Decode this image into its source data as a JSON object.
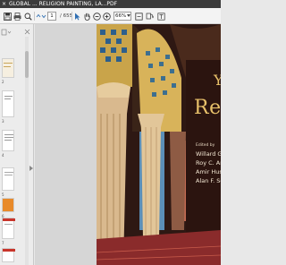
{
  "window": {
    "tab_close": "×",
    "title": "GLOBAL ... RELIGION PAINTING, LA...PDF"
  },
  "toolbar": {
    "page_current": "1",
    "page_total": "/ 655",
    "zoom": "66%",
    "icons": [
      "save-icon",
      "print-icon",
      "search-icon",
      "page-up-icon",
      "page-down-icon",
      "select-cursor-icon",
      "hand-tool-icon",
      "zoom-out-icon",
      "zoom-in-icon",
      "fit-page-icon",
      "rotate-icon",
      "share-icon"
    ]
  },
  "sidebar": {
    "thumbnails": [
      {
        "num": "1",
        "style": "cover"
      },
      {
        "num": "2",
        "style": "text"
      },
      {
        "num": "3",
        "style": "text"
      },
      {
        "num": "4",
        "style": "text"
      },
      {
        "num": "5",
        "style": "orange"
      },
      {
        "num": "6",
        "style": "red"
      },
      {
        "num": "7",
        "style": "red"
      },
      {
        "num": "8",
        "style": "text"
      }
    ]
  },
  "cover": {
    "title_fragment": "Rel",
    "accent_fragment": "Y",
    "edited_by": "Edited by",
    "editors": [
      "Willard G",
      "Roy C. Ar",
      "Amir Huss",
      "Alan F. Se"
    ]
  },
  "colors": {
    "titlebar": "#3b3b3b",
    "toolbar": "#f3f3f3",
    "icon_blue": "#2f6fb3",
    "cover_gold": "#e8c16a"
  }
}
